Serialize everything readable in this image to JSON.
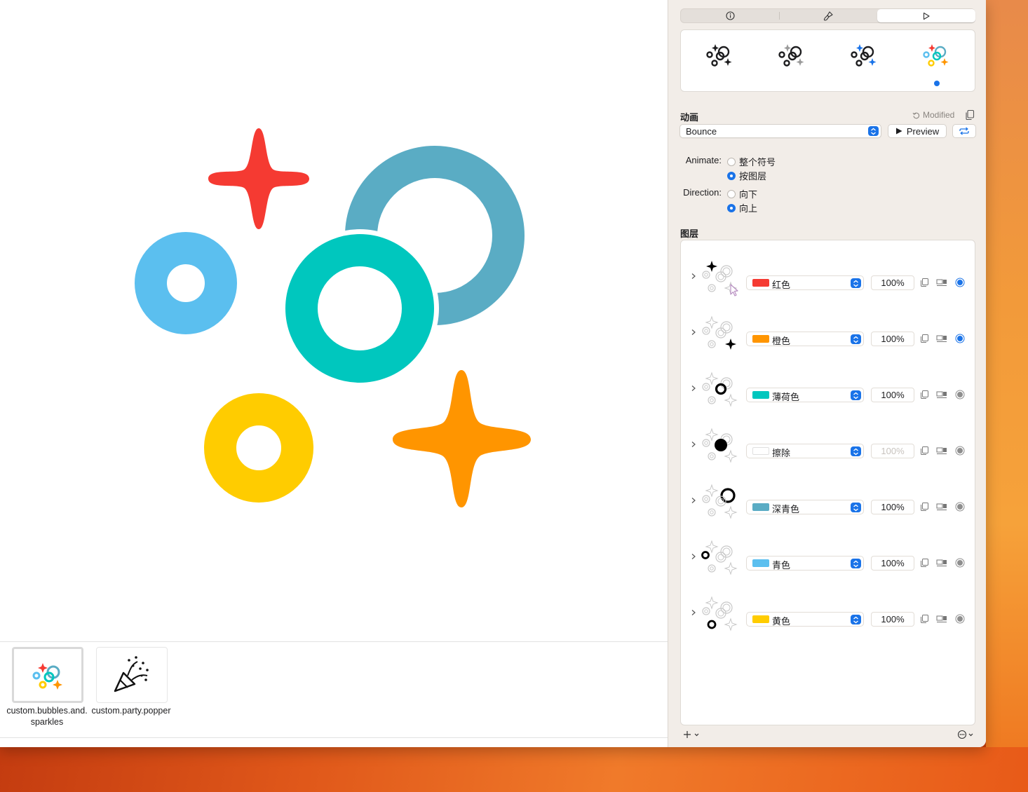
{
  "colors": {
    "red": "#f53a32",
    "orange": "#ff9500",
    "mint": "#00c7be",
    "teal": "#5aacc4",
    "cyan": "#5bbfef",
    "yellow": "#ffcc00",
    "accent": "#1a73e8"
  },
  "inspector": {
    "tabs": [
      "info-icon",
      "paintbrush-icon",
      "play-icon"
    ],
    "active_tab": 2,
    "variants": [
      "monochrome",
      "hierarchical",
      "palette",
      "multicolor"
    ],
    "selected_variant": 3
  },
  "animation": {
    "section_title": "动画",
    "modified_label": "Modified",
    "effect": "Bounce",
    "preview_label": "Preview",
    "animate_label": "Animate:",
    "animate_options": [
      "整个符号",
      "按图层"
    ],
    "animate_selected": 1,
    "direction_label": "Direction:",
    "direction_options": [
      "向下",
      "向上"
    ],
    "direction_selected": 1
  },
  "layers": {
    "section_title": "图层",
    "items": [
      {
        "color_name": "红色",
        "swatch": "#f53a32",
        "opacity": "100%",
        "active": true
      },
      {
        "color_name": "橙色",
        "swatch": "#ff9500",
        "opacity": "100%",
        "active": true
      },
      {
        "color_name": "薄荷色",
        "swatch": "#00c7be",
        "opacity": "100%",
        "active": false
      },
      {
        "color_name": "擦除",
        "swatch": "#ffffff",
        "opacity": "100%",
        "active": false
      },
      {
        "color_name": "深青色",
        "swatch": "#5aacc4",
        "opacity": "100%",
        "active": false
      },
      {
        "color_name": "青色",
        "swatch": "#5bbfef",
        "opacity": "100%",
        "active": false
      },
      {
        "color_name": "黄色",
        "swatch": "#ffcc00",
        "opacity": "100%",
        "active": false
      }
    ]
  },
  "gallery": {
    "items": [
      {
        "name": "custom.bubbles.and.sparkles",
        "selected": true
      },
      {
        "name": "custom.party.popper",
        "selected": false
      }
    ]
  }
}
